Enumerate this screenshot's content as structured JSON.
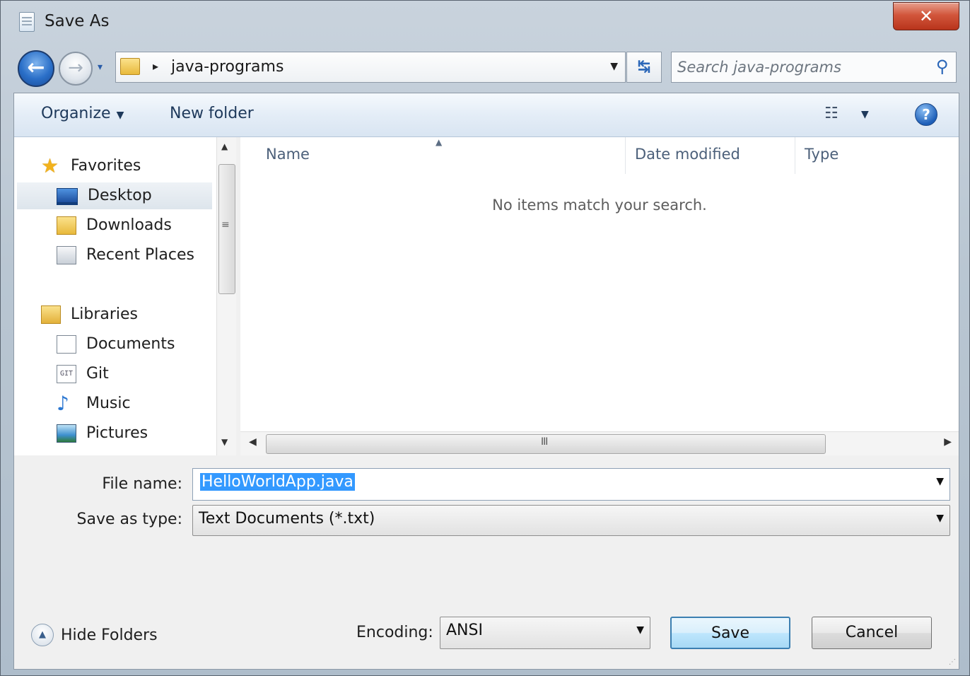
{
  "window": {
    "title": "Save As",
    "close_label": "✕"
  },
  "nav": {
    "back_glyph": "←",
    "forward_glyph": "→",
    "recent_glyph": "▾",
    "breadcrumb_arrow": "▸",
    "breadcrumb": "java-programs",
    "address_dropdown_glyph": "▼",
    "refresh_glyph": "↹"
  },
  "search": {
    "placeholder": "Search java-programs",
    "icon": "search-icon",
    "icon_glyph": "⚲"
  },
  "toolbar": {
    "organize_label": "Organize",
    "organize_caret": "▼",
    "new_folder_label": "New folder",
    "views_glyph": "☷",
    "views_caret": "▼",
    "help_glyph": "?"
  },
  "sidebar": {
    "favorites": {
      "label": "Favorites",
      "icon": "star-icon",
      "glyph": "★"
    },
    "favorites_items": [
      {
        "label": "Desktop",
        "icon": "desktop-icon",
        "selected": true
      },
      {
        "label": "Downloads",
        "icon": "downloads-folder-icon"
      },
      {
        "label": "Recent Places",
        "icon": "recent-places-icon"
      }
    ],
    "libraries": {
      "label": "Libraries",
      "icon": "libraries-icon"
    },
    "library_items": [
      {
        "label": "Documents",
        "icon": "documents-icon"
      },
      {
        "label": "Git",
        "icon": "git-icon",
        "glyph": "GIT"
      },
      {
        "label": "Music",
        "icon": "music-icon",
        "glyph": "♪"
      },
      {
        "label": "Pictures",
        "icon": "pictures-icon"
      }
    ],
    "scroll": {
      "up_glyph": "▲",
      "down_glyph": "▼",
      "grip_glyph": "≡"
    }
  },
  "filelist": {
    "columns": [
      "Name",
      "Date modified",
      "Type"
    ],
    "sort_glyph": "▲",
    "empty_message": "No items match your search."
  },
  "hscroll": {
    "left_glyph": "◀",
    "right_glyph": "▶",
    "grip_glyph": "III"
  },
  "form": {
    "file_name_label": "File name:",
    "file_name_value": "HelloWorldApp.java",
    "save_as_type_label": "Save as type:",
    "save_as_type_value": "Text Documents (*.txt)",
    "encoding_label": "Encoding:",
    "encoding_value": "ANSI",
    "dropdown_glyph": "▼"
  },
  "footer": {
    "hide_folders_label": "Hide Folders",
    "hide_folders_glyph": "▲",
    "save_label": "Save",
    "cancel_label": "Cancel",
    "resize_glyph": "⋰"
  },
  "colors": {
    "selection": "#3399ff",
    "accent": "#2a66b8",
    "close": "#c9452b"
  }
}
